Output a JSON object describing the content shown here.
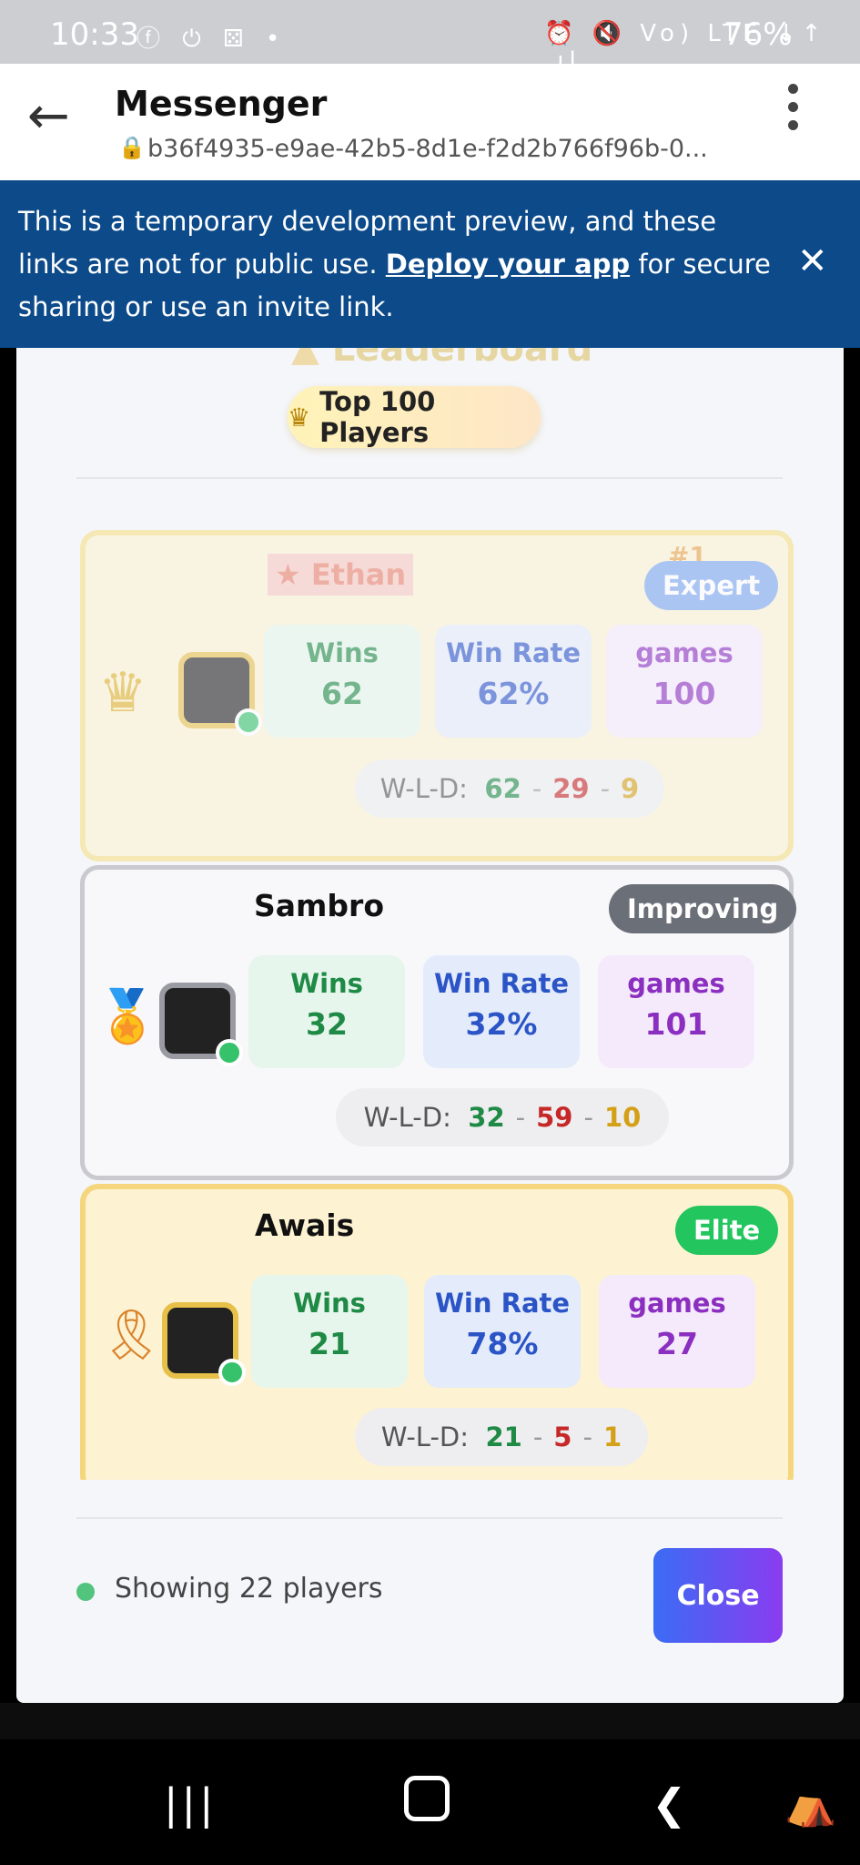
{
  "status_bar": {
    "time": "10:33",
    "icons_left": "ⓕ ⏻ ⚄ •",
    "icons_right": "⏰ 🔇 Vo) LTE ↓↑ .ıl",
    "battery": "76%"
  },
  "browser": {
    "title": "Messenger",
    "url": "b36f4935-e9ae-42b5-8d1e-f2d2b766f96b-0..."
  },
  "banner": {
    "text_before": "This is a temporary development preview, and these links are not for public use.",
    "link": "Deploy your app",
    "text_after": "for secure sharing or use an invite link."
  },
  "modal": {
    "title": "Leaderboard",
    "pill": "Top 100 Players",
    "stat_labels": {
      "wins": "Wins",
      "rate": "Win Rate",
      "games": "games"
    },
    "wld_label": "W-L-D:",
    "players": [
      {
        "name": "Ethan",
        "rank": "#1",
        "badge": "Expert",
        "wins": "62",
        "rate": "62%",
        "games": "100",
        "w": "62",
        "l": "29",
        "d": "9"
      },
      {
        "name": "Sambro",
        "badge": "Improving",
        "wins": "32",
        "rate": "32%",
        "games": "101",
        "w": "32",
        "l": "59",
        "d": "10"
      },
      {
        "name": "Awais",
        "badge": "Elite",
        "wins": "21",
        "rate": "78%",
        "games": "27",
        "w": "21",
        "l": "5",
        "d": "1"
      }
    ],
    "footer_status": "Showing 22 players",
    "close_label": "Close"
  },
  "colors": {
    "banner": "#0c4a8a",
    "expert": "#7ba6f0",
    "improving": "#6b6f78",
    "elite": "#22c55e"
  }
}
